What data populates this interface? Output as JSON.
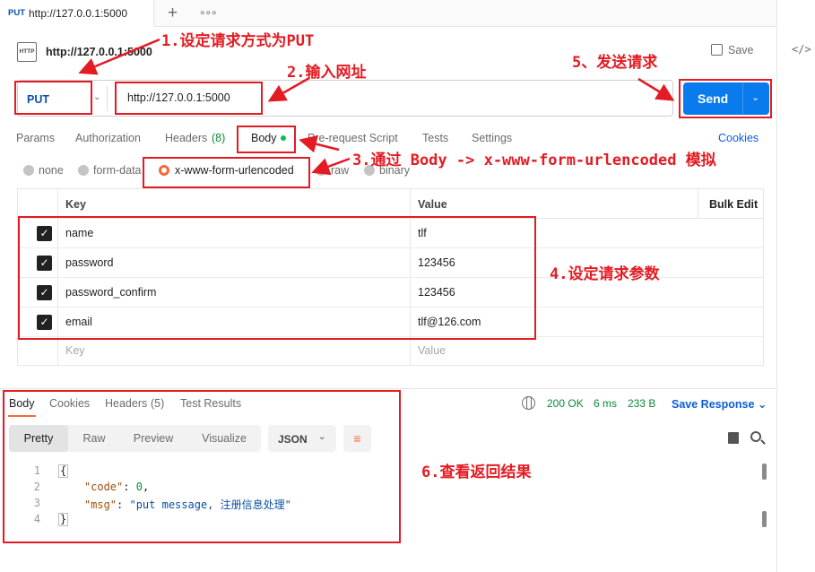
{
  "tab": {
    "method": "PUT",
    "url": "http://127.0.0.1:5000",
    "add": "+",
    "more": "∘∘∘"
  },
  "request": {
    "icon_text": "HTTP",
    "title": "http://127.0.0.1:5000",
    "save_label": "Save",
    "method": "PUT",
    "url_value": "http://127.0.0.1:5000",
    "send_label": "Send",
    "code_icon": "</>"
  },
  "request_tabs": {
    "params": "Params",
    "authorization": "Authorization",
    "headers": "Headers",
    "headers_count": "(8)",
    "body": "Body",
    "prerequest": "Pre-request Script",
    "tests": "Tests",
    "settings": "Settings",
    "cookies": "Cookies"
  },
  "body_types": [
    "none",
    "form-data",
    "x-www-form-urlencoded",
    "raw",
    "binary"
  ],
  "params_table": {
    "headers": {
      "key": "Key",
      "value": "Value",
      "bulk_edit": "Bulk Edit"
    },
    "rows": [
      {
        "key": "name",
        "value": "tlf"
      },
      {
        "key": "password",
        "value": "123456"
      },
      {
        "key": "password_confirm",
        "value": "123456"
      },
      {
        "key": "email",
        "value": "tlf@126.com"
      }
    ],
    "placeholder_key": "Key",
    "placeholder_value": "Value"
  },
  "response": {
    "tabs": {
      "body": "Body",
      "cookies": "Cookies",
      "headers": "Headers",
      "headers_count": "(5)",
      "test_results": "Test Results"
    },
    "status": "200 OK",
    "time": "6 ms",
    "size": "233 B",
    "save_response": "Save Response",
    "formats": [
      "Pretty",
      "Raw",
      "Preview",
      "Visualize"
    ],
    "format_select": "JSON",
    "code_lines": [
      {
        "num": "1",
        "text": "{"
      },
      {
        "num": "2",
        "key": "\"code\"",
        "value": "0"
      },
      {
        "num": "3",
        "key": "\"msg\"",
        "value": "\"put message, 注册信息处理\""
      },
      {
        "num": "4",
        "text": "}"
      }
    ]
  },
  "annotations": {
    "a1": "1.设定请求方式为PUT",
    "a2": "2.输入网址",
    "a3": "3.通过 Body -> x-www-form-urlencoded 模拟",
    "a4": "4.设定请求参数",
    "a5": "5、发送请求",
    "a6": "6.查看返回结果",
    "color": "#e31b23"
  },
  "colors": {
    "accent_blue": "#097bed",
    "method_blue": "#0b4fa8",
    "orange": "#f26b3a",
    "green": "#0b8a3a"
  }
}
